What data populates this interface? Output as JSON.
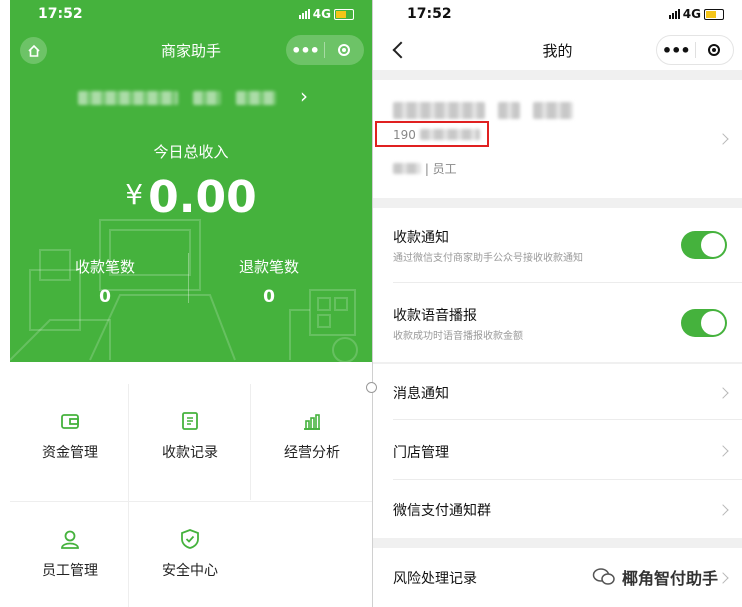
{
  "left_screen": {
    "status_bar": {
      "time": "17:52",
      "network": "4G"
    },
    "nav": {
      "title": "商家助手",
      "more_label": "•••"
    },
    "merchant_arrow": "›",
    "income": {
      "label": "今日总收入",
      "currency": "¥",
      "value": "0.00"
    },
    "stats": [
      {
        "label": "收款笔数",
        "value": "0"
      },
      {
        "label": "退款笔数",
        "value": "0"
      }
    ],
    "menu": [
      {
        "label": "资金管理",
        "icon": "wallet-icon"
      },
      {
        "label": "收款记录",
        "icon": "receipt-icon"
      },
      {
        "label": "经营分析",
        "icon": "chart-icon"
      },
      {
        "label": "员工管理",
        "icon": "person-icon"
      },
      {
        "label": "安全中心",
        "icon": "shield-icon"
      }
    ]
  },
  "right_screen": {
    "status_bar": {
      "time": "17:52",
      "network": "4G"
    },
    "nav": {
      "title": "我的",
      "more_label": "•••"
    },
    "profile": {
      "phone_prefix": "190",
      "role": "| 员工"
    },
    "settings": [
      {
        "title": "收款通知",
        "subtitle": "通过微信支付商家助手公众号接收收款通知",
        "toggle_on": true
      },
      {
        "title": "收款语音播报",
        "subtitle": "收款成功时语音播报收款金额",
        "toggle_on": true
      }
    ],
    "menu": [
      {
        "title": "消息通知"
      },
      {
        "title": "门店管理"
      },
      {
        "title": "微信支付通知群"
      },
      {
        "title": "风险处理记录"
      }
    ],
    "watermark": "椰角智付助手"
  },
  "colors": {
    "brand_green": "#45b23d",
    "highlight_red": "#e02020",
    "battery_yellow": "#f5c518"
  }
}
